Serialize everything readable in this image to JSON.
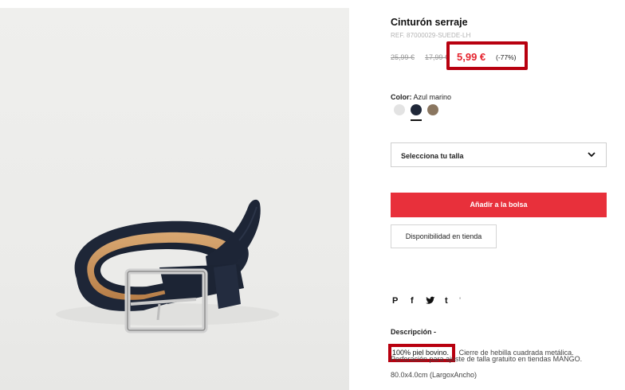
{
  "product": {
    "title": "Cinturón serraje",
    "ref": "REF. 87000029-SUEDE-LH",
    "old_price_1": "25,99 €",
    "old_price_2": "17,99 €",
    "price": "5,99 €",
    "discount": "(-77%)"
  },
  "color": {
    "label": "Color:",
    "value": "Azul marino",
    "swatches": [
      {
        "name": "light-grey",
        "hex": "#e3e3e3"
      },
      {
        "name": "navy",
        "hex": "#1f2738"
      },
      {
        "name": "taupe",
        "hex": "#8a7660"
      }
    ],
    "selected": "navy"
  },
  "size": {
    "placeholder": "Selecciona tu talla",
    "icon": "chevron-down-icon"
  },
  "actions": {
    "add_to_bag": "Añadir a la bolsa",
    "store_availability": "Disponibilidad en tienda"
  },
  "share": {
    "icons": [
      "pinterest-icon",
      "facebook-icon",
      "twitter-icon",
      "tumblr-icon",
      "more-icon"
    ],
    "glyphs": [
      "P",
      "f",
      "🐦",
      "t",
      "'"
    ]
  },
  "description": {
    "title": "Descripción  -",
    "highlight": "100% piel bovino.",
    "line1_rest": " Cierre de hebilla cuadrada metálica.",
    "line2": "Perforación para ajuste de talla gratuito en tiendas MANGO.",
    "line3": "80.0x4.0cm (LargoxAncho)"
  },
  "colors": {
    "accent_red": "#e8303b",
    "price_red": "#e5252f",
    "annotation_box": "#b8000f"
  }
}
